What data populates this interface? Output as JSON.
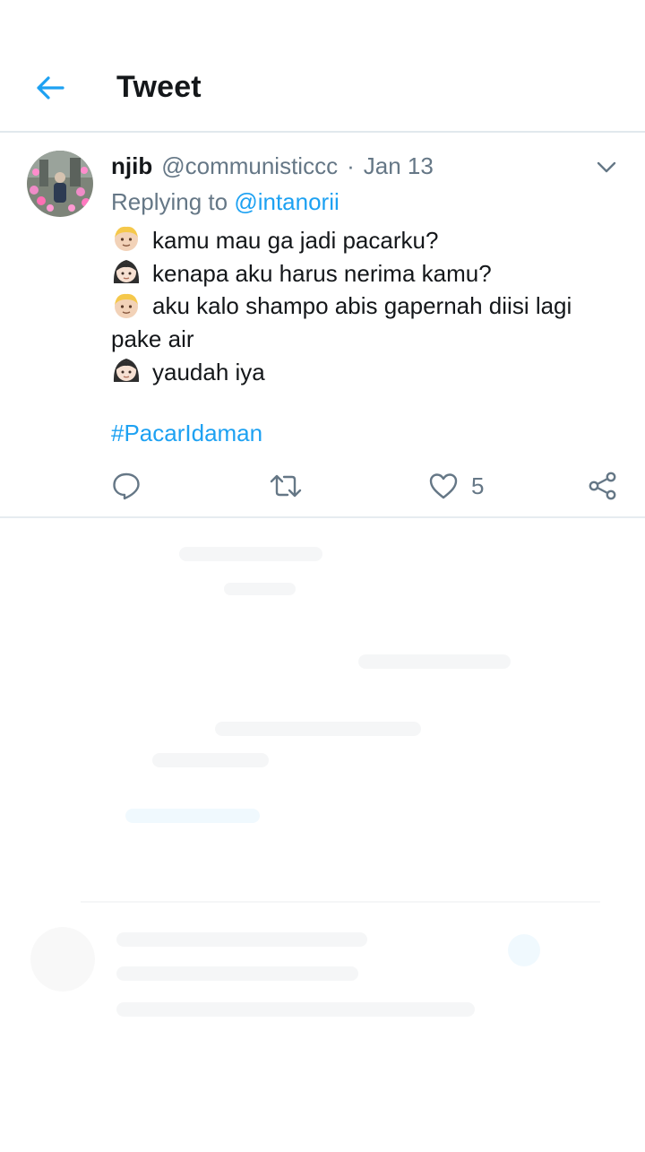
{
  "header": {
    "title": "Tweet",
    "back_icon": "arrow-left-icon"
  },
  "tweet": {
    "display_name": "njib",
    "handle": "@communisticcc",
    "separator": "·",
    "date": "Jan 13",
    "replying_prefix": "Replying to",
    "replying_to": "@intanorii",
    "lines": [
      {
        "emoji": "boy-emoji",
        "text": "kamu mau ga jadi pacarku?"
      },
      {
        "emoji": "girl-emoji",
        "text": "kenapa aku harus nerima kamu?"
      },
      {
        "emoji": "boy-emoji",
        "text": "aku kalo shampo abis gapernah diisi lagi pake air"
      },
      {
        "emoji": "girl-emoji",
        "text": "yaudah iya"
      }
    ],
    "hashtag": "#PacarIdaman",
    "likes": "5"
  },
  "colors": {
    "accent": "#1da1f2",
    "secondary_text": "#657786",
    "divider": "#e6ecf0"
  }
}
